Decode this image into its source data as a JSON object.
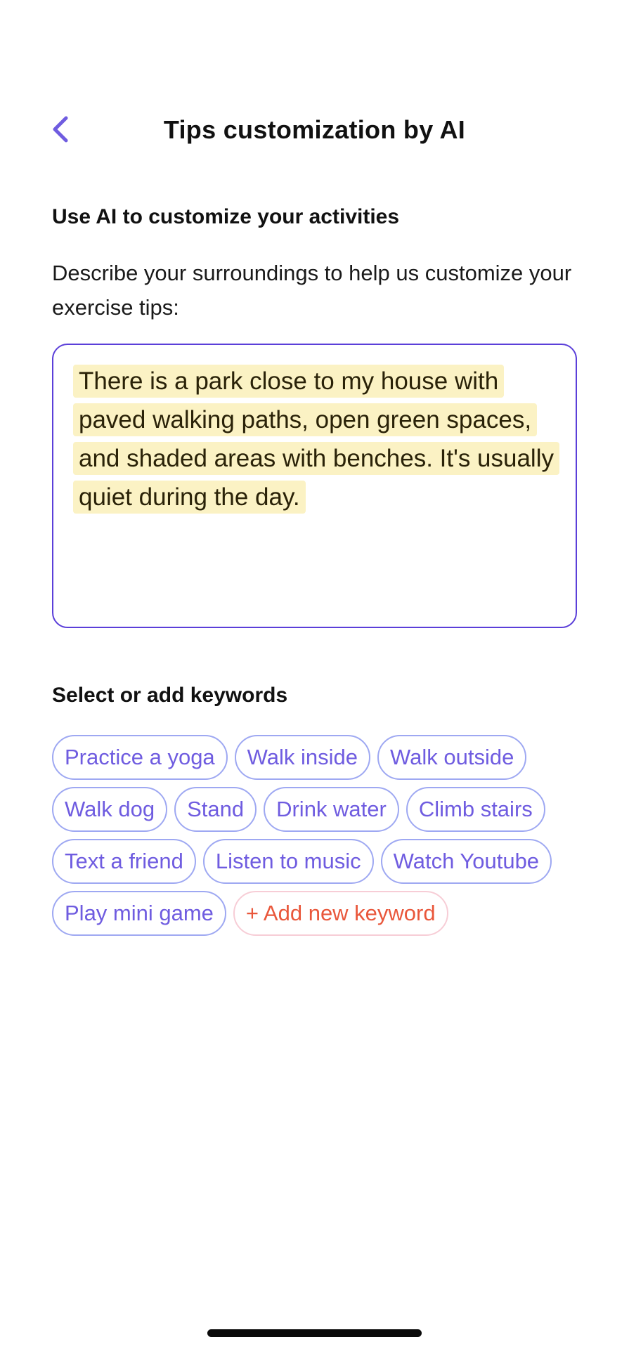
{
  "header": {
    "title": "Tips customization by AI"
  },
  "ai_section": {
    "heading": "Use AI to customize your activities",
    "description": "Describe your surroundings to help us customize your exercise tips:",
    "input_value": "There is a park close to my house with paved walking paths, open green spaces, and shaded areas with benches. It's usually quiet during the day."
  },
  "keywords_section": {
    "heading": "Select or add keywords",
    "chips": [
      "Practice a yoga",
      "Walk inside",
      "Walk outside",
      "Walk dog",
      "Stand",
      "Drink water",
      "Climb stairs",
      "Text a friend",
      "Listen to music",
      "Watch Youtube",
      "Play mini game"
    ],
    "add_label": "+ Add new keyword"
  },
  "colors": {
    "accent": "#5b3fd9",
    "chip_text": "#6f5ce0",
    "chip_border": "#9ea8f2",
    "add_text": "#e9573b",
    "add_border": "#f7cdd6",
    "highlight": "#fbf2c4"
  },
  "icons": {
    "back": "chevron-left-icon"
  }
}
